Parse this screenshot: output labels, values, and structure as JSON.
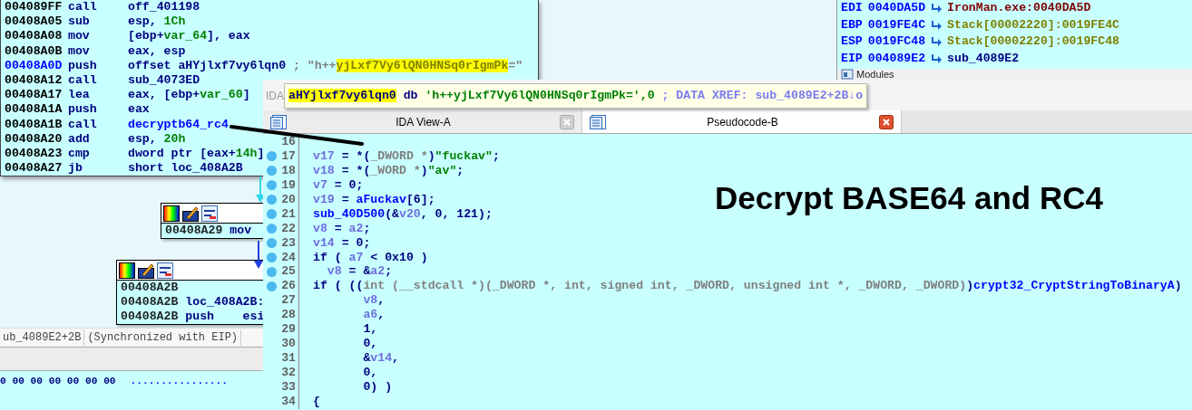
{
  "disassembly": {
    "rows": [
      {
        "address": "004089FF",
        "mnemonic": "call",
        "current": false,
        "operands": [
          {
            "text": "off_401198",
            "kind": "plain"
          }
        ]
      },
      {
        "address": "00408A05",
        "mnemonic": "sub",
        "current": false,
        "operands": [
          {
            "text": "esp, ",
            "kind": "plain"
          },
          {
            "text": "1Ch",
            "kind": "number"
          }
        ]
      },
      {
        "address": "00408A08",
        "mnemonic": "mov",
        "current": false,
        "operands": [
          {
            "text": "[ebp+",
            "kind": "plain"
          },
          {
            "text": "var_64",
            "kind": "variable"
          },
          {
            "text": "], eax",
            "kind": "plain"
          }
        ]
      },
      {
        "address": "00408A0B",
        "mnemonic": "mov",
        "current": false,
        "operands": [
          {
            "text": "eax, esp",
            "kind": "plain"
          }
        ]
      },
      {
        "address": "00408A0D",
        "mnemonic": "push",
        "current": true,
        "operands": [
          {
            "text": "offset aHYjlxf7vy6lqn0 ",
            "kind": "plain"
          },
          {
            "text": "; \"h++",
            "kind": "comment"
          },
          {
            "text": "yjLxf7Vy6lQN0HNSq0rIgmPk",
            "kind": "highlight"
          },
          {
            "text": "=\"",
            "kind": "comment"
          }
        ]
      },
      {
        "address": "00408A12",
        "mnemonic": "call",
        "current": false,
        "operands": [
          {
            "text": "sub_4073ED",
            "kind": "plain"
          }
        ]
      },
      {
        "address": "00408A17",
        "mnemonic": "lea",
        "current": false,
        "operands": [
          {
            "text": "eax, [ebp+",
            "kind": "plain"
          },
          {
            "text": "var_60",
            "kind": "variable"
          },
          {
            "text": "]",
            "kind": "plain"
          }
        ]
      },
      {
        "address": "00408A1A",
        "mnemonic": "push",
        "current": false,
        "operands": [
          {
            "text": "eax",
            "kind": "plain"
          }
        ]
      },
      {
        "address": "00408A1B",
        "mnemonic": "call",
        "current": false,
        "operands": [
          {
            "text": "decryptb64_rc4",
            "kind": "function"
          }
        ]
      },
      {
        "address": "00408A20",
        "mnemonic": "add",
        "current": false,
        "operands": [
          {
            "text": "esp, ",
            "kind": "plain"
          },
          {
            "text": "20h",
            "kind": "number"
          }
        ]
      },
      {
        "address": "00408A23",
        "mnemonic": "cmp",
        "current": false,
        "operands": [
          {
            "text": "dword ptr [eax+",
            "kind": "plain"
          },
          {
            "text": "14h",
            "kind": "number"
          },
          {
            "text": "]",
            "kind": "plain"
          }
        ]
      },
      {
        "address": "00408A27",
        "mnemonic": "jb",
        "current": false,
        "operands": [
          {
            "text": "short loc_408A2B",
            "kind": "plain"
          }
        ]
      }
    ]
  },
  "registers": {
    "rows": [
      {
        "name": "EDI",
        "value": "0040DA5D",
        "target": "IronMan.exe:0040DA5D",
        "kind": "module"
      },
      {
        "name": "EBP",
        "value": "0019FE4C",
        "target": "Stack[00002220]:0019FE4C",
        "kind": "stack"
      },
      {
        "name": "ESP",
        "value": "0019FC48",
        "target": "Stack[00002220]:0019FC48",
        "kind": "stack"
      },
      {
        "name": "EIP",
        "value": "004089E2",
        "target": "sub_4089E2",
        "kind": "function"
      }
    ],
    "modules_title": "Modules"
  },
  "graph": {
    "blocks": [
      {
        "rows": [
          {
            "address": "00408A29",
            "text": "mov"
          }
        ]
      },
      {
        "rows": [
          {
            "address": "00408A2B"
          },
          {
            "address": "00408A2B",
            "text": "loc_408A2B:"
          },
          {
            "address": "00408A2B",
            "text": "push    esi"
          }
        ]
      }
    ]
  },
  "status_bar": {
    "location": "ub_4089E2+2B",
    "sync": "(Synchronized with EIP)"
  },
  "hex_view": {
    "bytes": "0 00 00 00 00 00 00",
    "ascii": "................"
  },
  "pseudocode_window": {
    "title": "IDA",
    "hint": [
      {
        "text": "aHYjlxf7vy6lqn0",
        "kind": "label"
      },
      {
        "text": " db ",
        "kind": "plain"
      },
      {
        "text": "'h++yjLxf7Vy6lQN0HNSq0rIgmPk=',0",
        "kind": "string"
      },
      {
        "text": " ; DATA XREF: sub_4089E2+2B↓o",
        "kind": "xref"
      }
    ],
    "tabs": [
      {
        "label": "IDA View-A",
        "selected": false
      },
      {
        "label": "Pseudocode-B",
        "selected": true
      }
    ],
    "lines": [
      {
        "number": "16",
        "breakpoint": false
      },
      {
        "number": "17",
        "breakpoint": true,
        "segments": [
          {
            "text": "v17",
            "kind": "local"
          },
          {
            "text": " = *(",
            "kind": "plain"
          },
          {
            "text": "_DWORD *",
            "kind": "type"
          },
          {
            "text": ")",
            "kind": "plain"
          },
          {
            "text": "\"fuckav\"",
            "kind": "string"
          },
          {
            "text": ";",
            "kind": "plain"
          }
        ]
      },
      {
        "number": "18",
        "breakpoint": true,
        "segments": [
          {
            "text": "v18",
            "kind": "local"
          },
          {
            "text": " = *(",
            "kind": "plain"
          },
          {
            "text": "_WORD *",
            "kind": "type"
          },
          {
            "text": ")",
            "kind": "plain"
          },
          {
            "text": "\"av\"",
            "kind": "string"
          },
          {
            "text": ";",
            "kind": "plain"
          }
        ]
      },
      {
        "number": "19",
        "breakpoint": true,
        "segments": [
          {
            "text": "v7",
            "kind": "local"
          },
          {
            "text": " = 0;",
            "kind": "plain"
          }
        ]
      },
      {
        "number": "20",
        "breakpoint": true,
        "segments": [
          {
            "text": "v19",
            "kind": "local"
          },
          {
            "text": " = ",
            "kind": "plain"
          },
          {
            "text": "aFuckav",
            "kind": "function"
          },
          {
            "text": "[6];",
            "kind": "plain"
          }
        ]
      },
      {
        "number": "21",
        "breakpoint": true,
        "segments": [
          {
            "text": "sub_40D500",
            "kind": "function"
          },
          {
            "text": "(&",
            "kind": "plain"
          },
          {
            "text": "v20",
            "kind": "local"
          },
          {
            "text": ", 0, 121);",
            "kind": "plain"
          }
        ]
      },
      {
        "number": "22",
        "breakpoint": true,
        "segments": [
          {
            "text": "v8",
            "kind": "local"
          },
          {
            "text": " = ",
            "kind": "plain"
          },
          {
            "text": "a2",
            "kind": "local"
          },
          {
            "text": ";",
            "kind": "plain"
          }
        ]
      },
      {
        "number": "23",
        "breakpoint": true,
        "segments": [
          {
            "text": "v14",
            "kind": "local"
          },
          {
            "text": " = 0;",
            "kind": "plain"
          }
        ]
      },
      {
        "number": "24",
        "breakpoint": true,
        "segments": [
          {
            "text": "if ( ",
            "kind": "plain"
          },
          {
            "text": "a7",
            "kind": "local"
          },
          {
            "text": " < 0x10 )",
            "kind": "plain"
          }
        ]
      },
      {
        "number": "25",
        "breakpoint": true,
        "segments": [
          {
            "text": "  v8",
            "kind": "local"
          },
          {
            "text": " = &",
            "kind": "plain"
          },
          {
            "text": "a2",
            "kind": "local"
          },
          {
            "text": ";",
            "kind": "plain"
          }
        ]
      },
      {
        "number": "26",
        "breakpoint": true,
        "segments": [
          {
            "text": "if ( ((",
            "kind": "plain"
          },
          {
            "text": "int (__stdcall *)(_DWORD *, int, signed int, _DWORD, unsigned int *, _DWORD, _DWORD)",
            "kind": "type"
          },
          {
            "text": ")",
            "kind": "plain"
          },
          {
            "text": "crypt32_CryptStringToBinaryA",
            "kind": "function"
          },
          {
            "text": ")",
            "kind": "plain"
          }
        ]
      },
      {
        "number": "27",
        "breakpoint": false,
        "segments": [
          {
            "text": "       v8",
            "kind": "local"
          },
          {
            "text": ",",
            "kind": "plain"
          }
        ]
      },
      {
        "number": "28",
        "breakpoint": false,
        "segments": [
          {
            "text": "       a6",
            "kind": "local"
          },
          {
            "text": ",",
            "kind": "plain"
          }
        ]
      },
      {
        "number": "29",
        "breakpoint": false,
        "segments": [
          {
            "text": "       1,",
            "kind": "plain"
          }
        ]
      },
      {
        "number": "30",
        "breakpoint": false,
        "segments": [
          {
            "text": "       0,",
            "kind": "plain"
          }
        ]
      },
      {
        "number": "31",
        "breakpoint": false,
        "segments": [
          {
            "text": "       &",
            "kind": "plain"
          },
          {
            "text": "v14",
            "kind": "local"
          },
          {
            "text": ",",
            "kind": "plain"
          }
        ]
      },
      {
        "number": "32",
        "breakpoint": false,
        "segments": [
          {
            "text": "       0,",
            "kind": "plain"
          }
        ]
      },
      {
        "number": "33",
        "breakpoint": false,
        "segments": [
          {
            "text": "       0) )",
            "kind": "plain"
          }
        ]
      },
      {
        "number": "34",
        "breakpoint": false,
        "segments": [
          {
            "text": "{",
            "kind": "plain"
          }
        ]
      }
    ]
  },
  "annotation": {
    "text": "Decrypt BASE64 and RC4"
  }
}
